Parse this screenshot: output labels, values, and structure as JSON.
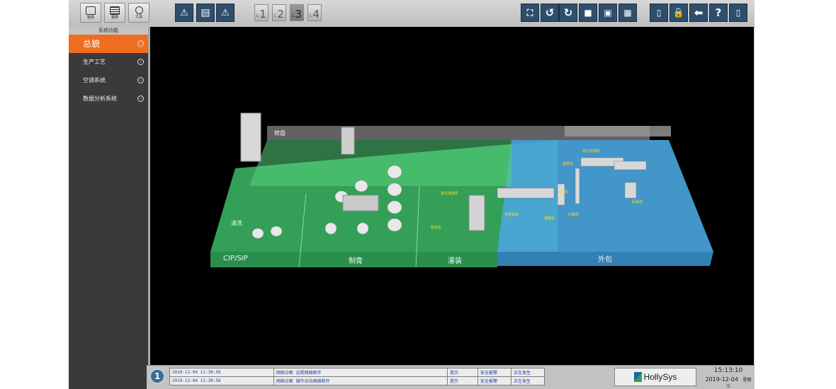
{
  "toolbar": {
    "left_buttons": [
      {
        "label": "窗体",
        "icon": "window-icon"
      },
      {
        "label": "报表",
        "icon": "report-icon"
      },
      {
        "label": "工具",
        "icon": "gear-icon"
      }
    ],
    "page_buttons": [
      "1",
      "2",
      "3",
      "4"
    ],
    "selected_page": "3"
  },
  "sidebar": {
    "title": "系统功能",
    "items": [
      {
        "label": "总貌"
      },
      {
        "label": "生产工艺"
      },
      {
        "label": "空调系统"
      },
      {
        "label": "数据分析系统"
      }
    ]
  },
  "scene": {
    "zones": [
      "CIP/SIP",
      "制膏",
      "灌装",
      "外包"
    ],
    "area_labels": [
      "转盘",
      "清洗"
    ],
    "equipment_labels": [
      "填充灌装机",
      "贴标机",
      "装箱机",
      "封箱机",
      "电子监管码",
      "装盒机",
      "二维码",
      "称重剔除",
      "码垛机"
    ]
  },
  "status": {
    "alarms": [
      {
        "time": "2019-12-04 11:30:56",
        "message": "网络诊断 远程网络断开",
        "type": "提示",
        "category": "安全报警",
        "state": "正在发生"
      },
      {
        "time": "2019-12-04 11:30:56",
        "message": "网络诊断 操作员站网络断开",
        "type": "提示",
        "category": "安全报警",
        "state": "正在发生"
      }
    ],
    "alarm_count": "1",
    "brand": "HollySys",
    "time": "15:13:10",
    "date": "2019-12-04",
    "weekday": "星期三"
  },
  "colors": {
    "accent": "#ef6d1f",
    "green_zone": "#3ec26a",
    "blue_zone": "#4aa6df",
    "toolbar_dark": "#2e4e6c"
  }
}
